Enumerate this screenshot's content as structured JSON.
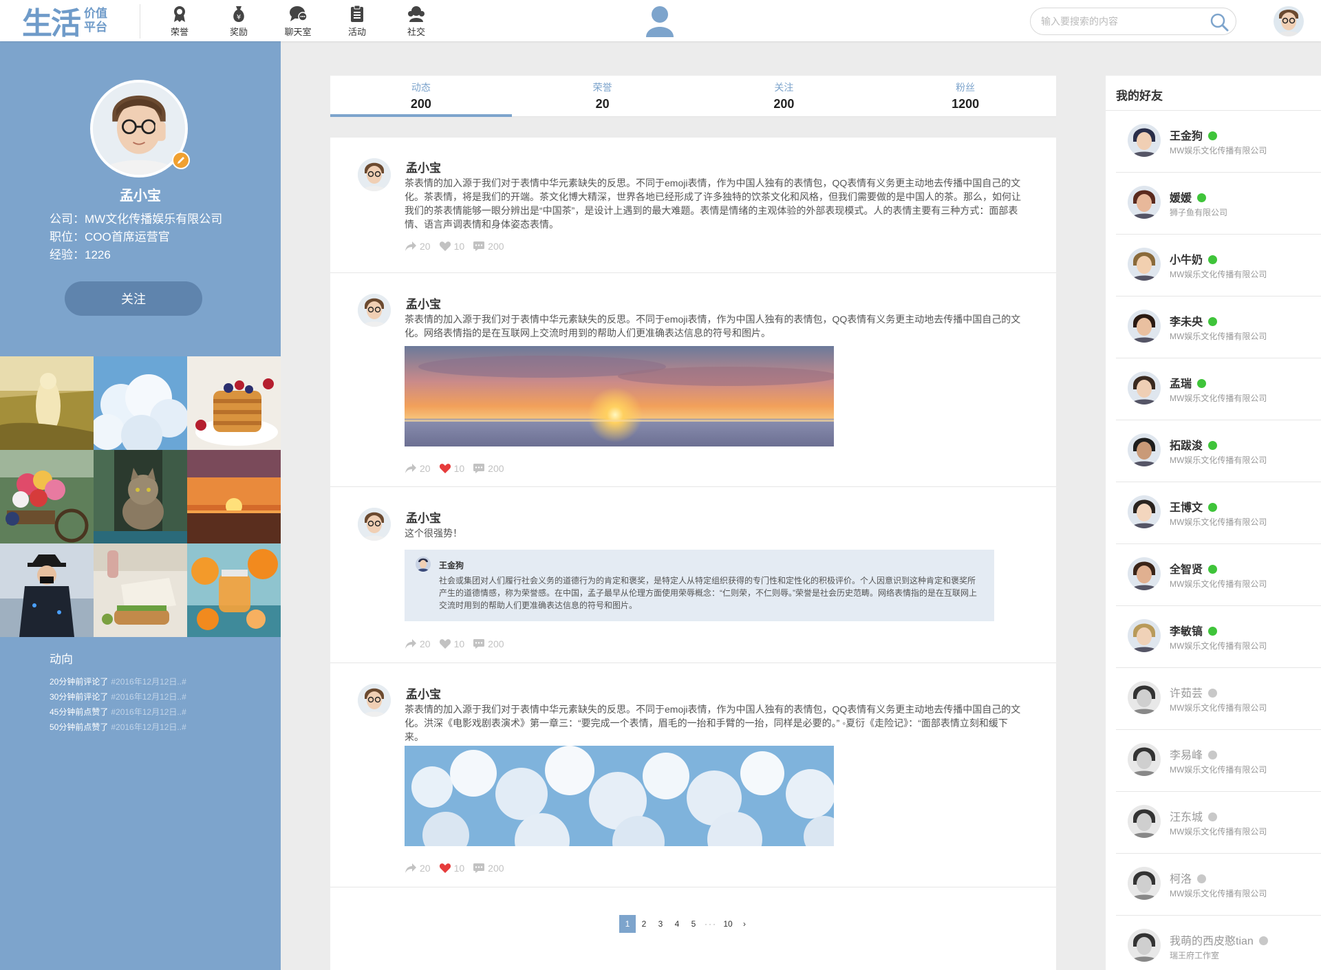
{
  "header": {
    "logo_big": "生活",
    "logo_small_1": "价值",
    "logo_small_2": "平台",
    "nav": [
      {
        "label": "荣誉",
        "icon": "honor-medal-icon"
      },
      {
        "label": "奖励",
        "icon": "money-bag-icon"
      },
      {
        "label": "聊天室",
        "icon": "chat-bubble-icon"
      },
      {
        "label": "活动",
        "icon": "clipboard-icon"
      },
      {
        "label": "社交",
        "icon": "people-icon"
      }
    ],
    "search_placeholder": "输入要搜索的内容"
  },
  "profile": {
    "name": "孟小宝",
    "company": "公司：MW文化传播娱乐有限公司",
    "position": "职位：COO首席运营官",
    "experience": "经验：1226",
    "follow_label": "关注"
  },
  "activity": {
    "title": "动向",
    "items": [
      {
        "text": "20分钟前评论了",
        "tag": "#2016年12月12日..#"
      },
      {
        "text": "30分钟前评论了",
        "tag": "#2016年12月12日..#"
      },
      {
        "text": "45分钟前点赞了",
        "tag": "#2016年12月12日..#"
      },
      {
        "text": "50分钟前点赞了",
        "tag": "#2016年12月12日..#"
      }
    ]
  },
  "stats": [
    {
      "label": "动态",
      "value": "200"
    },
    {
      "label": "荣誉",
      "value": "20"
    },
    {
      "label": "关注",
      "value": "200"
    },
    {
      "label": "粉丝",
      "value": "1200"
    }
  ],
  "posts": [
    {
      "author": "孟小宝",
      "text": "茶表情的加入源于我们对于表情中华元素缺失的反思。不同于emoji表情，作为中国人独有的表情包，QQ表情有义务更主动地去传播中国自己的文化。茶表情，将是我们的开端。茶文化博大精深，世界各地已经形成了许多独特的饮茶文化和风格，但我们需要做的是中国人的茶。那么，如何让我们的茶表情能够一眼分辨出是“中国茶”，是设计上遇到的最大难题。表情是情绪的主观体验的外部表现模式。人的表情主要有三种方式：面部表情、语言声调表情和身体姿态表情。",
      "shares": "20",
      "likes": "10",
      "comments": "200",
      "liked": false
    },
    {
      "author": "孟小宝",
      "text": "茶表情的加入源于我们对于表情中华元素缺失的反思。不同于emoji表情，作为中国人独有的表情包，QQ表情有义务更主动地去传播中国自己的文化。网络表情指的是在互联网上交流时用到的帮助人们更准确表达信息的符号和图片。",
      "shares": "20",
      "likes": "10",
      "comments": "200",
      "liked": true
    },
    {
      "author": "孟小宝",
      "text": "这个很强势！",
      "quote": {
        "author": "王金狗",
        "text": "社会或集团对人们履行社会义务的道德行为的肯定和褒奖，是特定人从特定组织获得的专门性和定性化的积极评价。个人因意识到这种肯定和褒奖所产生的道德情感，称为荣誉感。在中国，孟子最早从伦理方面使用荣辱概念：“仁则荣，不仁则辱。”荣誉是社会历史范畴。网络表情指的是在互联网上交流时用到的帮助人们更准确表达信息的符号和图片。"
      },
      "shares": "20",
      "likes": "10",
      "comments": "200",
      "liked": false
    },
    {
      "author": "孟小宝",
      "text": "茶表情的加入源于我们对于表情中华元素缺失的反思。不同于emoji表情，作为中国人独有的表情包，QQ表情有义务更主动地去传播中国自己的文化。洪深《电影戏剧表演术》第一章三：“要完成一个表情，眉毛的一抬和手臂的一抬，同样是必要的。” ◦夏衍《走险记》：“面部表情立刻和缓下来。",
      "shares": "20",
      "likes": "10",
      "comments": "200",
      "liked": true
    }
  ],
  "pager": {
    "pages": [
      "1",
      "2",
      "3",
      "4",
      "5"
    ],
    "ellipsis": "···",
    "last": "10",
    "next": "›",
    "current": "1"
  },
  "friends": {
    "title": "我的好友",
    "online_color": "#3fc43a",
    "offline_color": "#c8c8c8",
    "items": [
      {
        "name": "王金狗",
        "company": "MW娱乐文化传播有限公司",
        "online": true
      },
      {
        "name": "媛媛",
        "company": "狮子鱼有限公司",
        "online": true
      },
      {
        "name": "小牛奶",
        "company": "MW娱乐文化传播有限公司",
        "online": true
      },
      {
        "name": "李未央",
        "company": "MW娱乐文化传播有限公司",
        "online": true
      },
      {
        "name": "孟瑞",
        "company": "MW娱乐文化传播有限公司",
        "online": true
      },
      {
        "name": "拓跋浚",
        "company": "MW娱乐文化传播有限公司",
        "online": true
      },
      {
        "name": "王博文",
        "company": "MW娱乐文化传播有限公司",
        "online": true
      },
      {
        "name": "全智贤",
        "company": "MW娱乐文化传播有限公司",
        "online": true
      },
      {
        "name": "李敏镐",
        "company": "MW娱乐文化传播有限公司",
        "online": true
      },
      {
        "name": "许茹芸",
        "company": "MW娱乐文化传播有限公司",
        "online": false
      },
      {
        "name": "李易峰",
        "company": "MW娱乐文化传播有限公司",
        "online": false
      },
      {
        "name": "汪东城",
        "company": "MW娱乐文化传播有限公司",
        "online": false
      },
      {
        "name": "柯洛",
        "company": "MW娱乐文化传播有限公司",
        "online": false
      },
      {
        "name": "我萌的西皮憨tian",
        "company": "瑞王府工作室",
        "online": false
      }
    ]
  },
  "colors": {
    "accent": "#7da4cc",
    "sidebar": "#7da4cc",
    "like_red": "#e63c3c"
  }
}
